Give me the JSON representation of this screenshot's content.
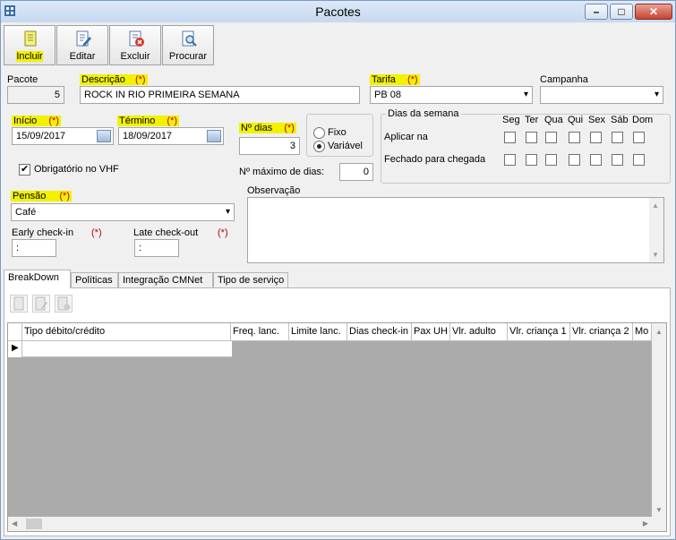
{
  "window": {
    "title": "Pacotes"
  },
  "toolbar": {
    "incluir": "Incluir",
    "editar": "Editar",
    "excluir": "Excluir",
    "procurar": "Procurar"
  },
  "form": {
    "required_mark": "(*)",
    "pacote_label": "Pacote",
    "pacote_value": "5",
    "descricao_label": "Descrição",
    "descricao_value": "ROCK IN RIO PRIMEIRA SEMANA",
    "tarifa_label": "Tarifa",
    "tarifa_value": "PB 08",
    "campanha_label": "Campanha",
    "campanha_value": "",
    "inicio_label": "Início",
    "inicio_value": "15/09/2017",
    "termino_label": "Término",
    "termino_value": "18/09/2017",
    "ndias_label": "Nº dias",
    "ndias_value": "3",
    "fixo_label": "Fixo",
    "variavel_label": "Variável",
    "nmax_label": "Nº máximo de dias:",
    "nmax_value": "0",
    "obrigatorio_label": "Obrigatório no VHF",
    "pensao_label": "Pensão",
    "pensao_value": "Café",
    "early_label": "Early check-in",
    "early_value": ":",
    "late_label": "Late check-out",
    "late_value": ":",
    "observacao_label": "Observação"
  },
  "dias_semana": {
    "title": "Dias da semana",
    "days": [
      "Seg",
      "Ter",
      "Qua",
      "Qui",
      "Sex",
      "Sáb",
      "Dom"
    ],
    "aplicar_label": "Aplicar na",
    "fechado_label": "Fechado para chegada"
  },
  "tabs": [
    "BreakDown",
    "Políticas",
    "Integração CMNet",
    "Tipo de serviço"
  ],
  "grid": {
    "columns": [
      "Tipo débito/crédito",
      "Freq. lanc.",
      "Limite lanc.",
      "Dias check-in",
      "Pax UH",
      "Vlr. adulto",
      "Vlr. criança 1",
      "Vlr. criança 2",
      "Mo"
    ]
  },
  "colors": {
    "highlight": "#f2f200",
    "required": "#c00000",
    "titlebar": "#c6d9f1",
    "close_button": "#c7432e"
  }
}
